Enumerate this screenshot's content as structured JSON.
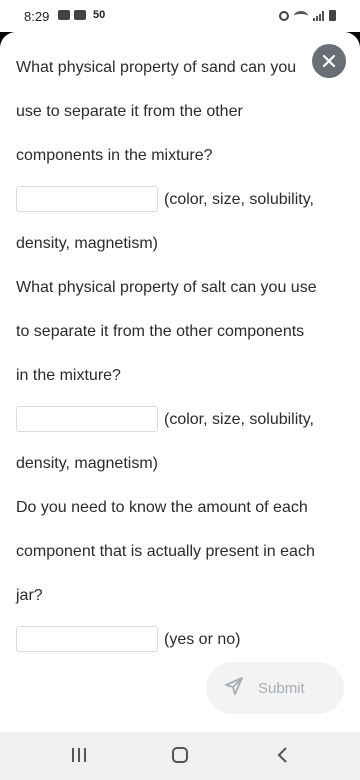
{
  "status": {
    "time": "8:29",
    "notification_count": "50",
    "left_icons": [
      "gmail-icon",
      "youtube-icon"
    ],
    "right_icons": [
      "alarm-icon",
      "wifi-icon",
      "signal-icon",
      "battery-icon"
    ]
  },
  "question1": {
    "lines": [
      "What physical property of sand can you",
      "use to separate it from the other",
      "components in the mixture?"
    ],
    "answer_value": "",
    "hint": "(color, size, solubility,",
    "hint_cont": "density, magnetism)"
  },
  "question2": {
    "lines": [
      "What physical property of salt can you use",
      "to separate it from the other components",
      "in the mixture?"
    ],
    "answer_value": "",
    "hint": "(color, size, solubility,",
    "hint_cont": "density, magnetism)"
  },
  "question3": {
    "lines": [
      "Do you need to know the amount of each",
      "component that is actually present in each",
      "jar?"
    ],
    "answer_value": "",
    "hint": "(yes or no)"
  },
  "close_icon": "close-icon",
  "submit_label": "Submit",
  "navigation": {
    "recent_icon": "recent-apps-icon",
    "home_icon": "home-icon",
    "back_icon": "back-icon"
  }
}
